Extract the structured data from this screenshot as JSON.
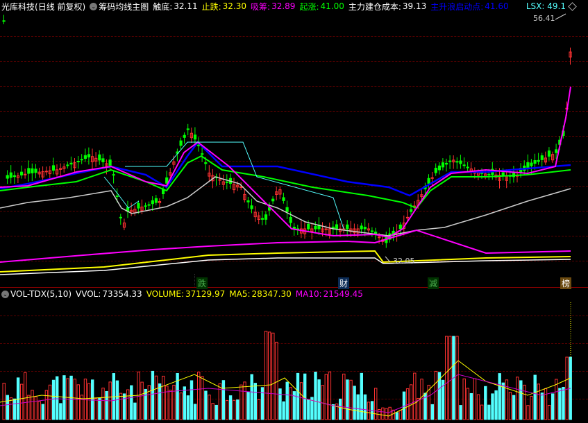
{
  "header": {
    "stock_name": "光库科技",
    "period": "(日线 前复权)",
    "indicator_name": "筹码均线主图",
    "touch_bottom_label": "触底:",
    "touch_bottom_value": "32.11",
    "stop_fall_label": "止跌:",
    "stop_fall_value": "32.30",
    "absorb_label": "吸筹:",
    "absorb_value": "32.89",
    "rise_label": "起涨:",
    "rise_value": "41.00",
    "cost_label": "主力建仓成本:",
    "cost_value": "39.13",
    "launch_label": "主升浪启动点:",
    "launch_value": "41.60",
    "lsx_label": "LSX:",
    "lsx_value": "49.1"
  },
  "price_labels": {
    "high": "56.41",
    "low": "32.05"
  },
  "markers": [
    {
      "text": "跌",
      "color": "#4caf50"
    },
    {
      "text": "财",
      "color": "#ffffff"
    },
    {
      "text": "减",
      "color": "#4caf50"
    },
    {
      "text": "榜",
      "color": "#ffffff"
    }
  ],
  "volume_header": {
    "name": "VOL-TDX(5,10)",
    "vvol_label": "VVOL:",
    "vvol_value": "73354.33",
    "volume_label": "VOLUME:",
    "volume_value": "37129.97",
    "ma5_label": "MA5:",
    "ma5_value": "28347.30",
    "ma10_label": "MA10:",
    "ma10_value": "21549.45"
  },
  "colors": {
    "up": "#ff3232",
    "down": "#00ff00",
    "vol_down": "#54ffff",
    "magenta": "#ff00ff",
    "blue": "#0000ff",
    "green_line": "#00ff00",
    "gray_line": "#cccccc",
    "cyan_line": "#54ffff",
    "yellow": "#ffff00",
    "white": "#ffffff",
    "purple": "#cc00cc"
  }
}
